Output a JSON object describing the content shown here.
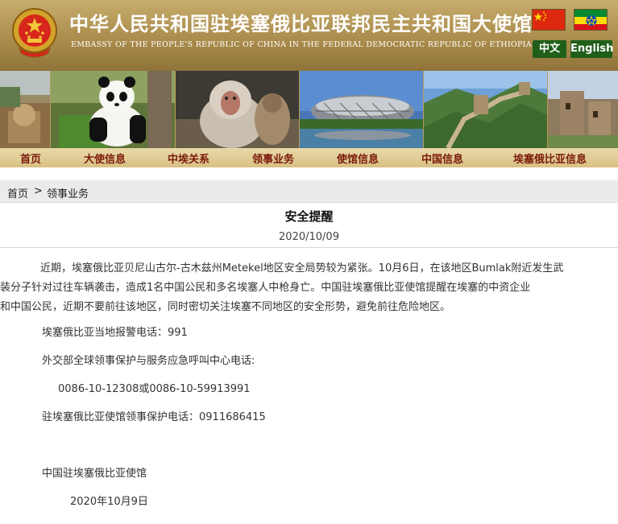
{
  "header": {
    "title_cn": "中华人民共和国驻埃塞俄比亚联邦民主共和国大使馆",
    "title_en": "EMBASSY OF THE PEOPLE'S REPUBLIC OF CHINA IN THE FEDERAL DEMOCRATIC REPUBLIC OF ETHIOPIA",
    "lang_cn": "中文",
    "lang_en": "English"
  },
  "nav": {
    "items": [
      "首页",
      "大使信息",
      "中埃关系",
      "领事业务",
      "使馆信息",
      "中国信息",
      "埃塞俄比亚信息"
    ]
  },
  "breadcrumb": {
    "home": "首页",
    "sep": ">",
    "current": "领事业务"
  },
  "article": {
    "title": "安全提醒",
    "date": "2020/10/09",
    "para1_lines": [
      "近期，埃塞俄比亚贝尼山古尔-古木兹州Metekel地区安全局势较为紧张。10月6日，在该地区Bumlak附近发生武",
      "装分子针对过往车辆袭击，造成1名中国公民和多名埃塞人中枪身亡。中国驻埃塞俄比亚使馆提醒在埃塞的中资企业",
      "和中国公民，近期不要前往该地区，同时密切关注埃塞不同地区的安全形势，避免前往危险地区。"
    ],
    "police_phone": "埃塞俄比亚当地报警电话：991",
    "mfa_hotline_label": "外交部全球领事保护与服务应急呼叫中心电话:",
    "mfa_hotline_numbers": "0086-10-12308或0086-10-59913991",
    "embassy_phone": "驻埃塞俄比亚使馆领事保护电话：0911686415",
    "signature": "中国驻埃塞俄比亚使馆",
    "signature_date": "2020年10月9日"
  },
  "colors": {
    "header_gold": "#a88a4a",
    "nav_text": "#7a1a0c",
    "lang_button": "#1f5f1a"
  },
  "icons": [
    "national-emblem-icon",
    "china-flag-icon",
    "ethiopia-flag-icon"
  ]
}
